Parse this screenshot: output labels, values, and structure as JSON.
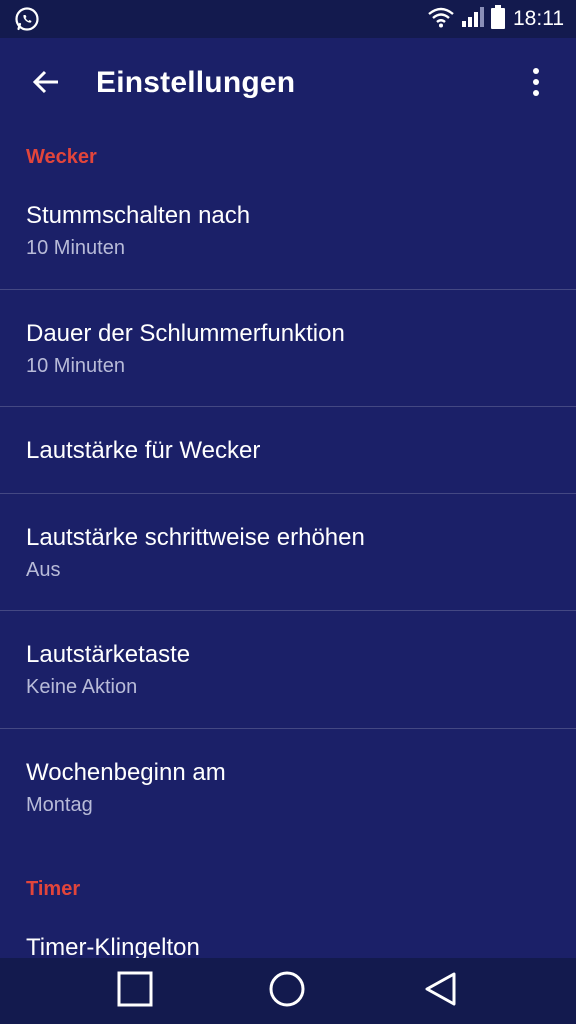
{
  "status_bar": {
    "time": "18:11",
    "left_icon": "whatsapp-icon",
    "right_icons": [
      "wifi-icon",
      "signal-icon",
      "battery-icon"
    ]
  },
  "app_bar": {
    "title": "Einstellungen",
    "back_icon": "arrow-back-icon",
    "menu_icon": "more-vert-icon"
  },
  "sections": {
    "alarm": {
      "header": "Wecker",
      "items": [
        {
          "title": "Stummschalten nach",
          "summary": "10 Minuten"
        },
        {
          "title": "Dauer der Schlummerfunktion",
          "summary": "10 Minuten"
        },
        {
          "title": "Lautstärke für Wecker",
          "summary": ""
        },
        {
          "title": "Lautstärke schrittweise erhöhen",
          "summary": "Aus"
        },
        {
          "title": "Lautstärketaste",
          "summary": "Keine Aktion"
        },
        {
          "title": "Wochenbeginn am",
          "summary": "Montag"
        }
      ]
    },
    "timer": {
      "header": "Timer",
      "items": [
        {
          "title": "Timer-Klingelton",
          "summary": ""
        }
      ]
    }
  },
  "nav_bar": {
    "icons": [
      "recents-square-icon",
      "home-circle-icon",
      "back-triangle-icon"
    ]
  },
  "colors": {
    "background": "#1b2068",
    "status_bar": "#131a4e",
    "section_header": "#e2453b",
    "title_text": "#ffffff",
    "summary_text": "#b8bbd8"
  }
}
